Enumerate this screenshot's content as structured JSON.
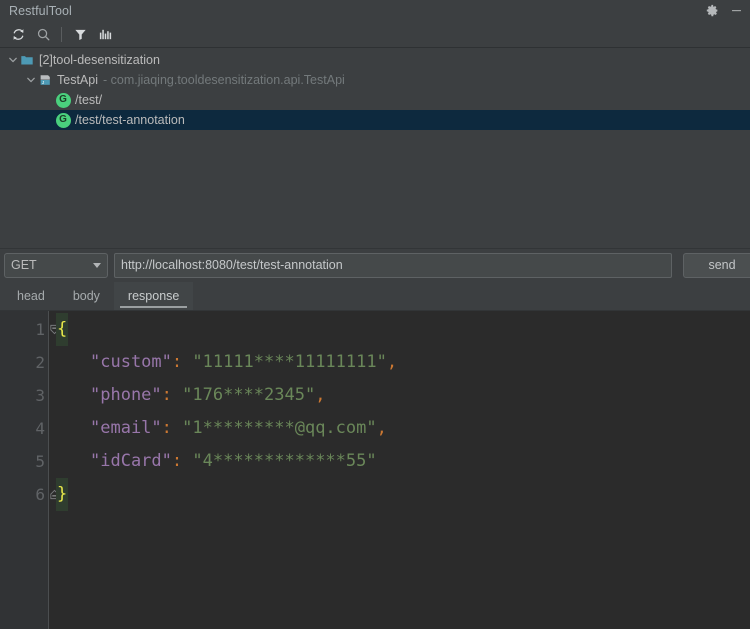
{
  "window": {
    "title": "RestfulTool",
    "actions": [
      {
        "name": "settings-icon",
        "label": "settings"
      },
      {
        "name": "minimize-icon",
        "label": "minimize"
      }
    ]
  },
  "toolbar": {
    "buttons": [
      {
        "name": "refresh-icon",
        "label": "Refresh"
      },
      {
        "name": "search-icon",
        "label": "Search"
      },
      {
        "name": "filter-icon",
        "label": "Filter"
      },
      {
        "name": "stats-icon",
        "label": "Statistics"
      }
    ]
  },
  "tree": {
    "module": {
      "label": "[2]tool-desensitization",
      "expanded": true
    },
    "class": {
      "label": "TestApi",
      "sublabel": "- com.jiaqing.tooldesensitization.api.TestApi",
      "expanded": true
    },
    "endpoints": [
      {
        "method_badge": "G",
        "path": "/test/",
        "selected": false
      },
      {
        "method_badge": "G",
        "path": "/test/test-annotation",
        "selected": true
      }
    ]
  },
  "request": {
    "method": "GET",
    "url": "http://localhost:8080/test/test-annotation",
    "url_placeholder": "http://localhost:8080/",
    "send_label": "send"
  },
  "tabs": [
    {
      "label": "head",
      "active": false
    },
    {
      "label": "body",
      "active": false
    },
    {
      "label": "response",
      "active": true
    }
  ],
  "response": {
    "lines": [
      {
        "number": "1",
        "fold": "collapse",
        "tokens": [
          {
            "type": "brace",
            "text": "{"
          }
        ]
      },
      {
        "number": "2",
        "fold": "",
        "indent": true,
        "tokens": [
          {
            "type": "key",
            "text": "\"custom\""
          },
          {
            "type": "punct",
            "text": ":"
          },
          {
            "type": "str",
            "text": " \"11111****11111111\""
          },
          {
            "type": "punct",
            "text": ","
          }
        ]
      },
      {
        "number": "3",
        "fold": "",
        "indent": true,
        "tokens": [
          {
            "type": "key",
            "text": "\"phone\""
          },
          {
            "type": "punct",
            "text": ":"
          },
          {
            "type": "str",
            "text": " \"176****2345\""
          },
          {
            "type": "punct",
            "text": ","
          }
        ]
      },
      {
        "number": "4",
        "fold": "",
        "indent": true,
        "tokens": [
          {
            "type": "key",
            "text": "\"email\""
          },
          {
            "type": "punct",
            "text": ":"
          },
          {
            "type": "str",
            "text": " \"1*********@qq.com\""
          },
          {
            "type": "punct",
            "text": ","
          }
        ]
      },
      {
        "number": "5",
        "fold": "",
        "indent": true,
        "tokens": [
          {
            "type": "key",
            "text": "\"idCard\""
          },
          {
            "type": "punct",
            "text": ":"
          },
          {
            "type": "str",
            "text": " \"4*************55\""
          }
        ]
      },
      {
        "number": "6",
        "fold": "expand",
        "tokens": [
          {
            "type": "brace",
            "text": "}"
          }
        ]
      }
    ]
  },
  "colors": {
    "background": "#3c3f41",
    "editor_background": "#2b2b2b",
    "gutter_background": "#313335",
    "selection": "#0d293e",
    "badge_green": "#4ad07d",
    "string": "#6a8759",
    "key": "#9876aa",
    "punct": "#cc7832",
    "brace": "#e8e84a",
    "folder_icon": "#4d9ab5"
  }
}
